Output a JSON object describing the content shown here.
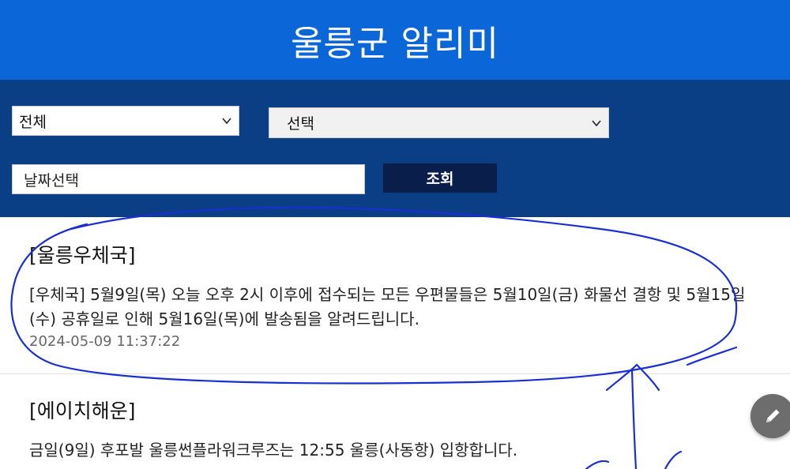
{
  "app": {
    "title": "울릉군 알리미"
  },
  "filters": {
    "category_selected": "전체",
    "choice_selected": "선택",
    "date_placeholder": "날짜선택",
    "search_label": "조회"
  },
  "notices": [
    {
      "title": "[울릉우체국]",
      "body": "[우체국] 5월9일(목) 오늘 오후 2시 이후에 접수되는 모든 우편물들은 5월10일(금) 화물선 결항 및 5월15일(수) 공휴일로 인해 5월16일(목)에 발송됨을 알려드립니다.",
      "datetime": "2024-05-09 11:37:22"
    },
    {
      "title": "[에이치해운]",
      "body": "금일(9일) 후포발 울릉썬플라워크루즈는 12:55 울릉(사동항) 입항합니다."
    }
  ],
  "colors": {
    "header": "#0b66d8",
    "filter_panel": "#0a3e85",
    "button": "#0a1e4b",
    "annotation_ink": "#1a2fd1"
  },
  "icons": {
    "dropdown": "chevron-down-icon",
    "fab": "pencil-icon"
  }
}
